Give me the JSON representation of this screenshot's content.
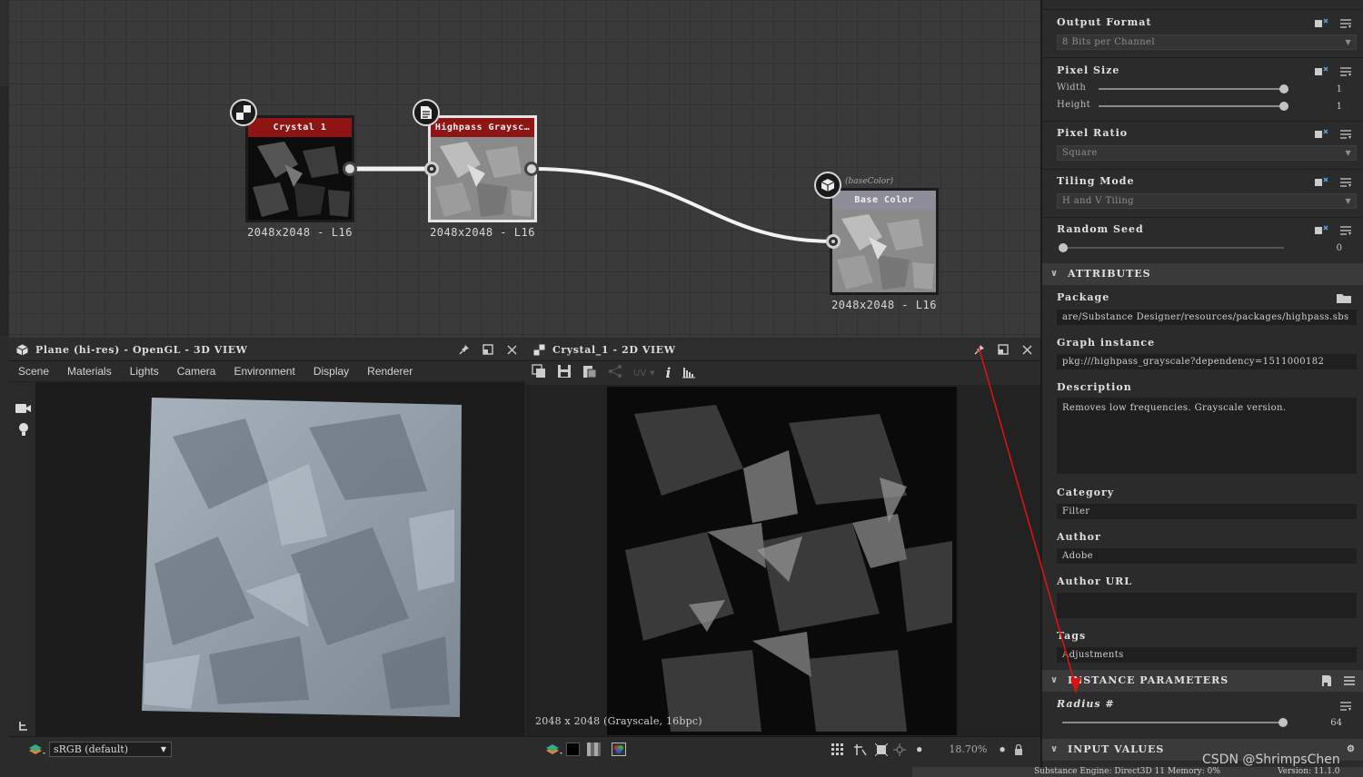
{
  "graph": {
    "nodes": [
      {
        "title": "Crystal 1",
        "resolution": "2048x2048 - L16"
      },
      {
        "title": "Highpass Graysc…",
        "resolution": "2048x2048 - L16"
      },
      {
        "title": "Base Color",
        "resolution": "2048x2048 - L16",
        "usage": "(baseColor)"
      }
    ]
  },
  "view3d": {
    "title": "Plane (hi-res) - OpenGL - 3D VIEW",
    "menu": [
      "Scene",
      "Materials",
      "Lights",
      "Camera",
      "Environment",
      "Display",
      "Renderer"
    ],
    "colorspace": "sRGB (default)"
  },
  "view2d": {
    "title": "Crystal_1 - 2D VIEW",
    "uv_label": "UV",
    "info": "2048 x 2048 (Grayscale, 16bpc)",
    "zoom": "18.70%"
  },
  "props": {
    "output_format": {
      "label": "Output Format",
      "value": "8 Bits per Channel"
    },
    "pixel_size": {
      "label": "Pixel Size",
      "width_label": "Width",
      "width_value": "1",
      "height_label": "Height",
      "height_value": "1"
    },
    "pixel_ratio": {
      "label": "Pixel Ratio",
      "value": "Square"
    },
    "tiling_mode": {
      "label": "Tiling Mode",
      "value": "H and V Tiling"
    },
    "random_seed": {
      "label": "Random Seed",
      "value": "0"
    },
    "attributes_header": "ATTRIBUTES",
    "package": {
      "label": "Package",
      "value": "are/Substance Designer/resources/packages/highpass.sbs"
    },
    "graph_instance": {
      "label": "Graph instance",
      "value": "pkg:///highpass_grayscale?dependency=1511000182"
    },
    "description": {
      "label": "Description",
      "value": "Removes low frequencies. Grayscale version."
    },
    "category": {
      "label": "Category",
      "value": "Filter"
    },
    "author": {
      "label": "Author",
      "value": "Adobe"
    },
    "author_url": {
      "label": "Author URL",
      "value": ""
    },
    "tags": {
      "label": "Tags",
      "value": "Adjustments"
    },
    "instance_header": "INSTANCE PARAMETERS",
    "radius": {
      "label": "Radius #",
      "value": "64"
    },
    "input_header": "INPUT VALUES"
  },
  "status": {
    "engine": "Substance Engine: Direct3D 11 Memory: 0%",
    "version": "Version: 11.1.0"
  },
  "watermark": "CSDN @ShrimpsChen",
  "colors": {
    "node_title": "#8f1414",
    "output_title": "#8d8d99",
    "annotation": "#e01010"
  }
}
